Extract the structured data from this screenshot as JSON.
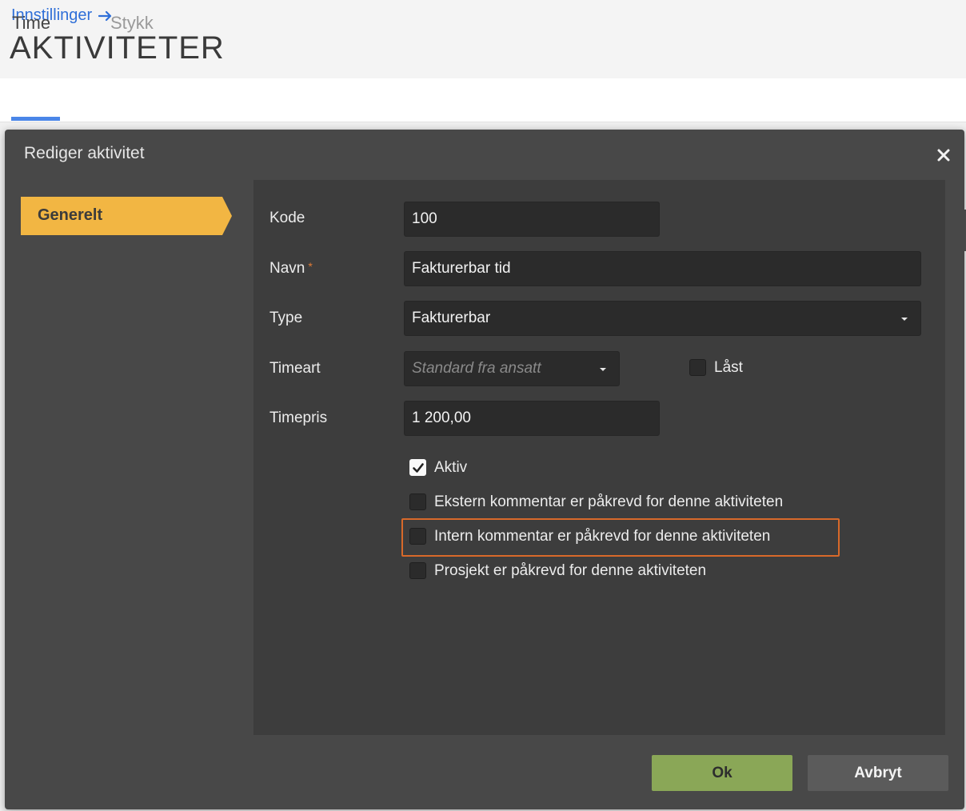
{
  "header": {
    "breadcrumb": "Innstillinger",
    "title": "AKTIVITETER"
  },
  "tabs": [
    {
      "label": "Time",
      "active": true
    },
    {
      "label": "Stykk",
      "active": false
    }
  ],
  "modal": {
    "title": "Rediger aktivitet",
    "nav": [
      {
        "label": "Generelt",
        "active": true
      }
    ],
    "fields": {
      "kode": {
        "label": "Kode",
        "value": "100"
      },
      "navn": {
        "label": "Navn",
        "required_mark": "*",
        "value": "Fakturerbar tid"
      },
      "type": {
        "label": "Type",
        "value": "Fakturerbar"
      },
      "timeart": {
        "label": "Timeart",
        "placeholder": "Standard fra ansatt"
      },
      "laast": {
        "label": "Låst",
        "checked": false
      },
      "timepris": {
        "label": "Timepris",
        "value": "1 200,00"
      }
    },
    "checkboxes": [
      {
        "label": "Aktiv",
        "checked": true
      },
      {
        "label": "Ekstern kommentar er påkrevd for denne aktiviteten",
        "checked": false
      },
      {
        "label": "Intern kommentar er påkrevd for denne aktiviteten",
        "checked": false
      },
      {
        "label": "Prosjekt er påkrevd for denne aktiviteten",
        "checked": false
      }
    ],
    "buttons": {
      "ok": "Ok",
      "cancel": "Avbryt"
    }
  },
  "colors": {
    "accent_tab": "#4a86e8",
    "nav_active": "#f2b643",
    "ok_button": "#8aa757",
    "highlight": "#d8692a",
    "link": "#2f6fd8"
  }
}
